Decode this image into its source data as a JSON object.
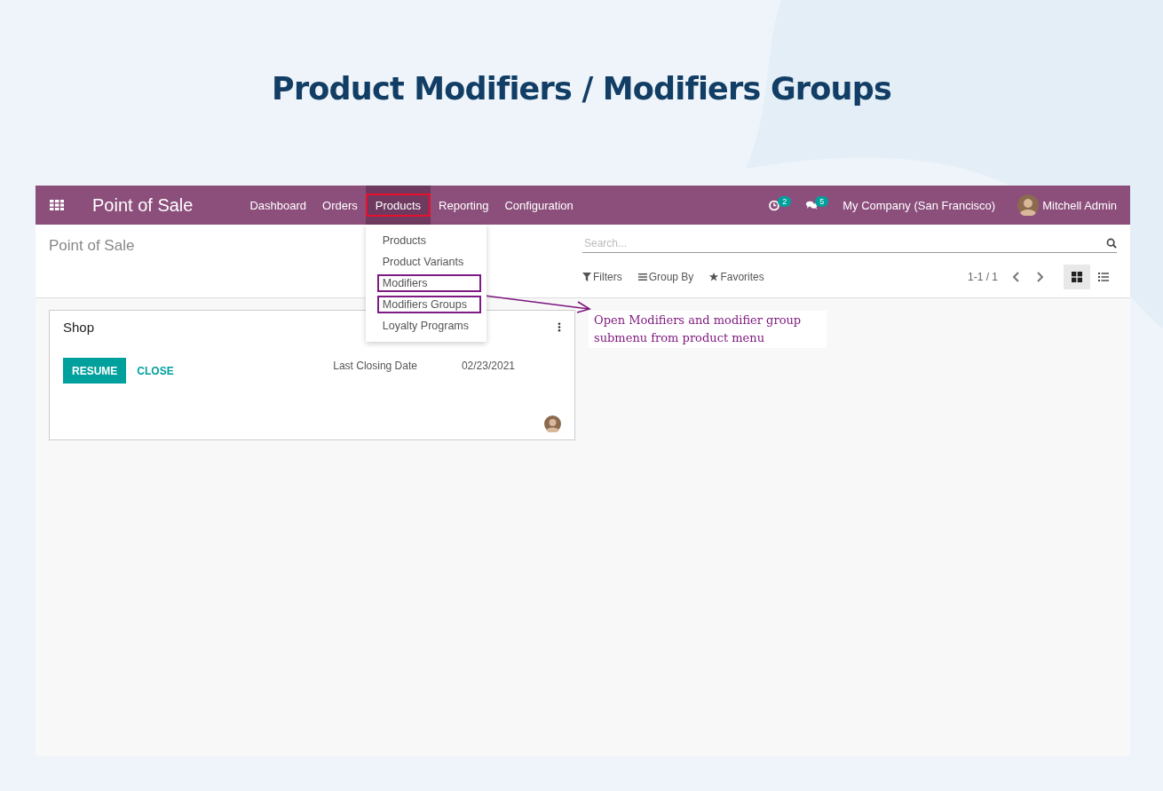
{
  "heading": "Product Modifiers / Modifiers Groups",
  "navbar": {
    "app_title": "Point of Sale",
    "menu": [
      {
        "label": "Dashboard",
        "selected": false
      },
      {
        "label": "Orders",
        "selected": false
      },
      {
        "label": "Products",
        "selected": true,
        "dropdown": [
          {
            "label": "Products",
            "outlined": false
          },
          {
            "label": "Product Variants",
            "outlined": false
          },
          {
            "label": "Modifiers",
            "outlined": true
          },
          {
            "label": "Modifiers Groups",
            "outlined": true
          },
          {
            "label": "Loyalty Programs",
            "outlined": false
          }
        ]
      },
      {
        "label": "Reporting",
        "selected": false
      },
      {
        "label": "Configuration",
        "selected": false
      }
    ],
    "activity_count": "2",
    "message_count": "5",
    "company": "My Company (San Francisco)",
    "user": "Mitchell Admin"
  },
  "control_panel": {
    "breadcrumb": "Point of Sale",
    "search": {
      "placeholder": "Search..."
    },
    "filters": "Filters",
    "group_by": "Group By",
    "favorites": "Favorites",
    "pager": "1-1 / 1",
    "views": [
      {
        "kind": "kanban",
        "selected": true
      },
      {
        "kind": "list",
        "selected": false
      }
    ]
  },
  "card": {
    "title": "Shop",
    "buttons": [
      "RESUME",
      "CLOSE"
    ],
    "field_label": "Last Closing Date",
    "field_value": "02/23/2021"
  },
  "annotation": "Open Modifiers and modifier group submenu from product menu"
}
